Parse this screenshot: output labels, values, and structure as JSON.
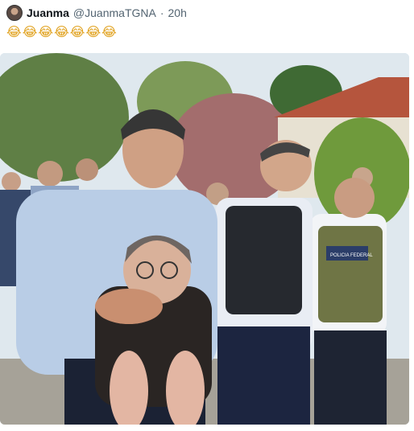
{
  "tweet": {
    "author_name": "Juanma",
    "author_handle": "@JuanmaTGNA",
    "separator": "·",
    "time_ago": "20h",
    "text": "😂😂😂😂😂😂😂"
  },
  "media": {
    "vest_patch_text": "POLICIA FEDERAL"
  },
  "colors": {
    "accent_text": "#536471",
    "emoji_face": "#f5c33b"
  },
  "icons": [
    "avatar-image"
  ]
}
